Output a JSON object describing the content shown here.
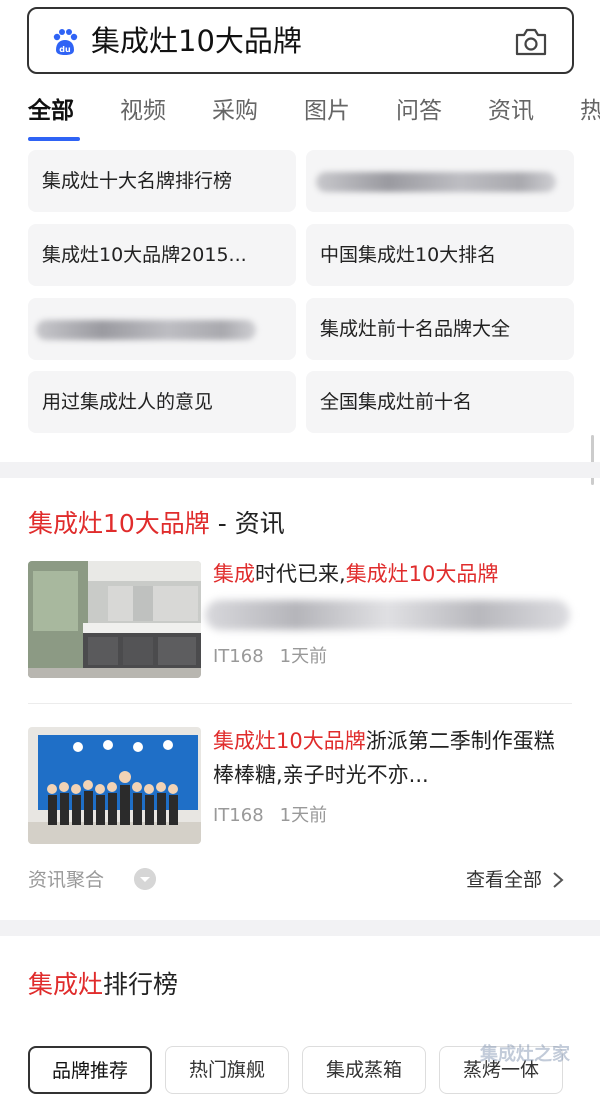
{
  "search": {
    "query": "集成灶10大品牌",
    "logo_text": "du"
  },
  "tabs": [
    "全部",
    "视频",
    "采购",
    "图片",
    "问答",
    "资讯",
    "热"
  ],
  "related": {
    "chips": [
      "集成灶十大名牌排行榜",
      "",
      "集成灶10大品牌2015...",
      "中国集成灶10大排名",
      "",
      "集成灶前十名品牌大全",
      "用过集成灶人的意见",
      "全国集成灶前十名"
    ]
  },
  "news": {
    "title_highlight": "集成灶10大品牌",
    "title_suffix": " - 资讯",
    "items": [
      {
        "headline_parts": [
          {
            "text": "集成",
            "red": true
          },
          {
            "text": "时代已来,",
            "red": false
          },
          {
            "text": "集成灶10大品牌",
            "red": true
          }
        ],
        "source": "IT168",
        "time": "1天前"
      },
      {
        "headline_parts": [
          {
            "text": "集成灶10大品牌",
            "red": true
          },
          {
            "text": "浙派第二季制作蛋糕棒棒糖,亲子时光不亦...",
            "red": false
          }
        ],
        "source": "IT168",
        "time": "1天前"
      }
    ],
    "aggregate_label": "资讯聚合",
    "view_all": "查看全部"
  },
  "ranking": {
    "title_highlight": "集成灶",
    "title_suffix": "排行榜",
    "chips": [
      "品牌推荐",
      "热门旗舰",
      "集成蒸箱",
      "蒸烤一体"
    ]
  },
  "watermark": "集成灶之家",
  "colors": {
    "accent_blue": "#2f63f5",
    "highlight_red": "#e02c2c"
  }
}
